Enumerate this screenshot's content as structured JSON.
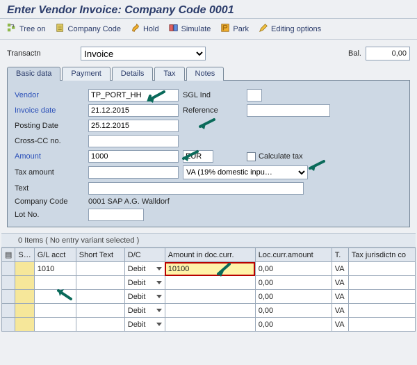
{
  "title": "Enter Vendor Invoice: Company Code 0001",
  "toolbar": {
    "tree_on": "Tree on",
    "company_code": "Company Code",
    "hold": "Hold",
    "simulate": "Simulate",
    "park": "Park",
    "editing_options": "Editing options"
  },
  "transactn": {
    "label": "Transactn",
    "value": "Invoice"
  },
  "balance": {
    "label": "Bal.",
    "value": "0,00"
  },
  "tabs": [
    "Basic data",
    "Payment",
    "Details",
    "Tax",
    "Notes"
  ],
  "active_tab": 0,
  "form": {
    "vendor": {
      "label": "Vendor",
      "value": "TP_PORT_HH"
    },
    "sgl_ind": {
      "label": "SGL Ind",
      "value": ""
    },
    "invoice_date": {
      "label": "Invoice date",
      "value": "21.12.2015"
    },
    "reference": {
      "label": "Reference",
      "value": ""
    },
    "posting_date": {
      "label": "Posting Date",
      "value": "25.12.2015"
    },
    "cross_cc": {
      "label": "Cross-CC no.",
      "value": ""
    },
    "amount": {
      "label": "Amount",
      "value": "1000",
      "currency": "EUR"
    },
    "calc_tax": {
      "label": "Calculate tax",
      "checked": false
    },
    "tax_amount": {
      "label": "Tax amount",
      "value": ""
    },
    "tax_code": {
      "value": "VA (19% domestic inpu…"
    },
    "text": {
      "label": "Text",
      "value": ""
    },
    "company_code": {
      "label": "Company Code",
      "value": "0001 SAP A.G. Walldorf"
    },
    "lot_no": {
      "label": "Lot No.",
      "value": ""
    }
  },
  "grid": {
    "caption": "0 Items ( No entry variant selected )",
    "columns": [
      "S…",
      "G/L acct",
      "Short Text",
      "D/C",
      "Amount in doc.curr.",
      "Loc.curr.amount",
      "T.",
      "Tax jurisdictn co"
    ],
    "rows": [
      {
        "gl": "1010",
        "dc": "Debit",
        "amount_doc": "10100",
        "amount_loc": "0,00",
        "tax": "VA"
      },
      {
        "gl": "",
        "dc": "Debit",
        "amount_doc": "",
        "amount_loc": "0,00",
        "tax": "VA"
      },
      {
        "gl": "",
        "dc": "Debit",
        "amount_doc": "",
        "amount_loc": "0,00",
        "tax": "VA"
      },
      {
        "gl": "",
        "dc": "Debit",
        "amount_doc": "",
        "amount_loc": "0,00",
        "tax": "VA"
      },
      {
        "gl": "",
        "dc": "Debit",
        "amount_doc": "",
        "amount_loc": "0,00",
        "tax": "VA"
      }
    ]
  }
}
